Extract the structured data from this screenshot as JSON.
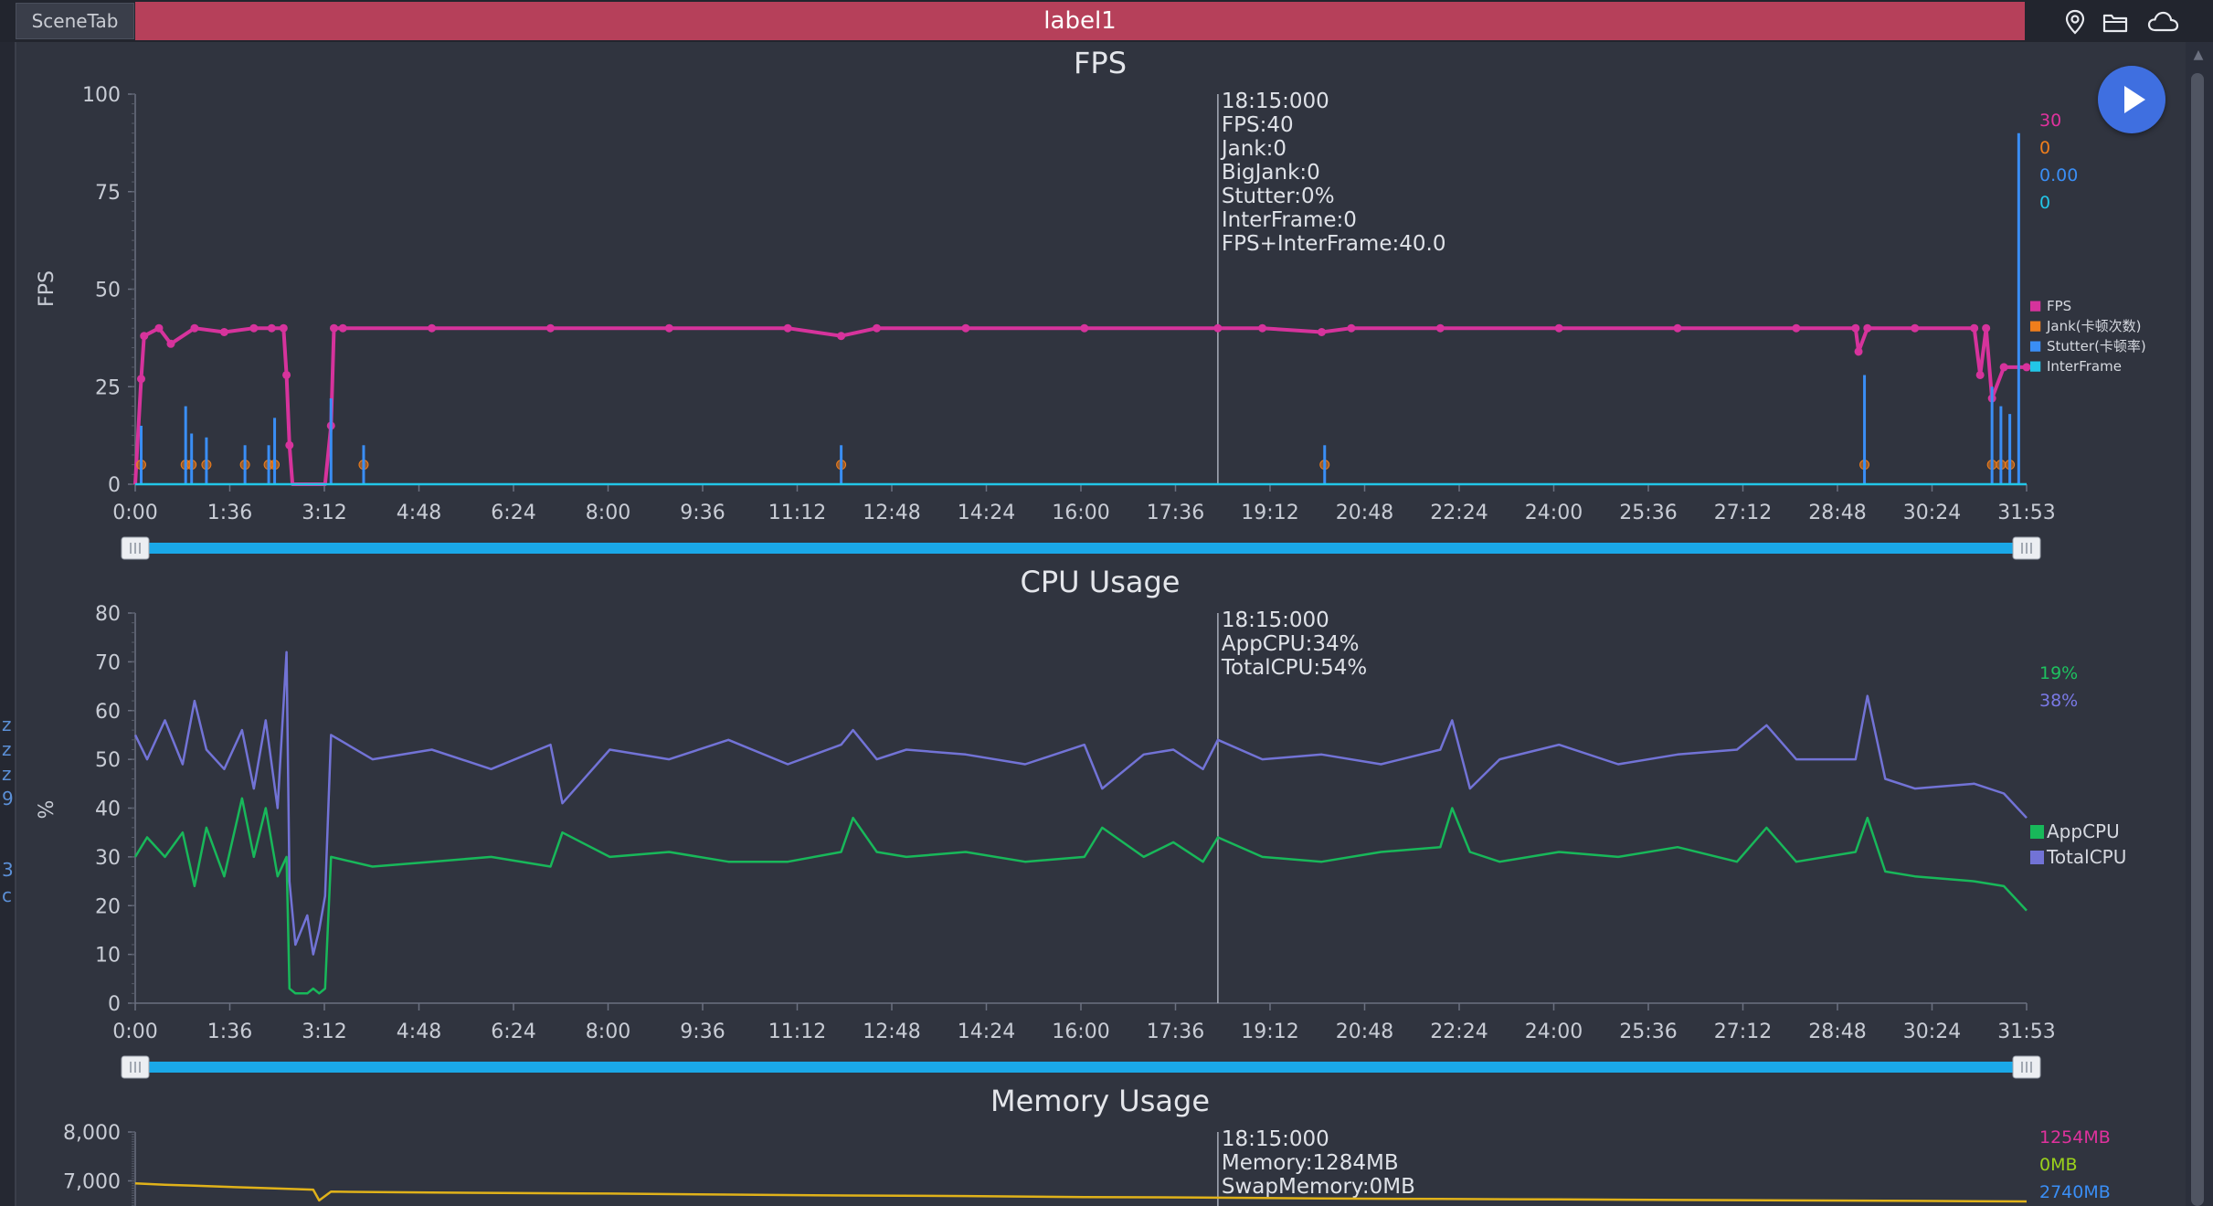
{
  "header": {
    "scene_tab": "SceneTab",
    "label": "label1",
    "icons": [
      "location-pin-icon",
      "folder-icon",
      "cloud-icon"
    ]
  },
  "sidebar_glyphs": [
    "z",
    "z",
    "z",
    "9",
    "3",
    "c"
  ],
  "play_button": {
    "icon": "play-icon",
    "color": "#3f6fe0"
  },
  "x_ticks": [
    "0:00",
    "1:36",
    "3:12",
    "4:48",
    "6:24",
    "8:00",
    "9:36",
    "11:12",
    "12:48",
    "14:24",
    "16:00",
    "17:36",
    "19:12",
    "20:48",
    "22:24",
    "24:00",
    "25:36",
    "27:12",
    "28:48",
    "30:24",
    "31:53"
  ],
  "cursor_time_minutes": 18.25,
  "chart_data": [
    {
      "type": "line",
      "title": "FPS",
      "ylabel": "FPS",
      "ylim": [
        0,
        100
      ],
      "y_ticks": [
        "100",
        "75",
        "50",
        "25",
        "0"
      ],
      "x_range_minutes": [
        0,
        31.883
      ],
      "legend_position": "right",
      "tooltip": [
        "18:15:000",
        "FPS:40",
        "Jank:0",
        "BigJank:0",
        "Stutter:0%",
        "InterFrame:0",
        "FPS+InterFrame:40.0"
      ],
      "current_values": [
        {
          "text": "30",
          "color": "#e0329e"
        },
        {
          "text": "0",
          "color": "#f07e1c"
        },
        {
          "text": "0.00",
          "color": "#3a8ef5"
        },
        {
          "text": "0",
          "color": "#22c6e8"
        }
      ],
      "series": [
        {
          "name": "FPS",
          "color": "#d6339c",
          "x": [
            0,
            0.1,
            0.15,
            0.4,
            0.6,
            1.0,
            1.5,
            2.0,
            2.3,
            2.5,
            2.55,
            2.6,
            2.65,
            3.2,
            3.3,
            3.35,
            3.5,
            5,
            7,
            9,
            11,
            11.9,
            12.5,
            14,
            16,
            18.25,
            19,
            20,
            20.5,
            22,
            24,
            26,
            28,
            29,
            29.05,
            29.2,
            30,
            31,
            31.1,
            31.2,
            31.3,
            31.5,
            31.883
          ],
          "values": [
            0,
            27,
            38,
            40,
            36,
            40,
            39,
            40,
            40,
            40,
            28,
            10,
            0,
            0,
            15,
            40,
            40,
            40,
            40,
            40,
            40,
            38,
            40,
            40,
            40,
            40,
            40,
            39,
            40,
            40,
            40,
            40,
            40,
            40,
            34,
            40,
            40,
            40,
            28,
            40,
            22,
            30,
            30
          ]
        },
        {
          "name": "Jank(卡顿次数)",
          "color": "#f07e1c",
          "x": [
            0.1,
            0.85,
            0.95,
            1.2,
            1.85,
            2.25,
            2.35,
            3.85,
            11.9,
            20.05,
            29.15,
            31.3,
            31.45,
            31.6
          ],
          "values": [
            5,
            5,
            5,
            5,
            5,
            5,
            5,
            5,
            5,
            5,
            5,
            5,
            5,
            5
          ]
        },
        {
          "name": "Stutter(卡顿率)",
          "color": "#3a8ef5",
          "x": [
            0.1,
            0.85,
            0.95,
            1.2,
            1.85,
            2.25,
            2.35,
            3.3,
            3.85,
            11.9,
            20.05,
            29.15,
            31.3,
            31.45,
            31.6,
            31.75
          ],
          "values": [
            15,
            20,
            13,
            12,
            10,
            10,
            17,
            22,
            10,
            10,
            10,
            28,
            25,
            20,
            18,
            90
          ]
        },
        {
          "name": "InterFrame",
          "color": "#22c6e8",
          "x": [
            0,
            31.883
          ],
          "values": [
            0,
            0
          ]
        }
      ]
    },
    {
      "type": "line",
      "title": "CPU Usage",
      "ylabel": "%",
      "ylim": [
        0,
        80
      ],
      "y_ticks": [
        "80",
        "70",
        "60",
        "50",
        "40",
        "30",
        "20",
        "10",
        "0"
      ],
      "x_range_minutes": [
        0,
        31.883
      ],
      "legend_position": "right",
      "tooltip": [
        "18:15:000",
        "AppCPU:34%",
        "TotalCPU:54%"
      ],
      "current_values": [
        {
          "text": "19%",
          "color": "#1ec15f"
        },
        {
          "text": "38%",
          "color": "#7a79e6"
        }
      ],
      "series": [
        {
          "name": "AppCPU",
          "color": "#18b85a",
          "x": [
            0,
            0.2,
            0.5,
            0.8,
            1.0,
            1.2,
            1.5,
            1.8,
            2.0,
            2.2,
            2.4,
            2.55,
            2.6,
            2.7,
            2.9,
            3.0,
            3.1,
            3.2,
            3.3,
            4,
            5,
            6,
            7,
            7.2,
            8,
            9,
            10,
            11,
            11.9,
            12.1,
            12.5,
            13,
            14,
            15,
            16,
            16.3,
            17,
            17.5,
            18,
            18.25,
            19,
            20,
            21,
            22,
            22.2,
            22.5,
            23,
            24,
            25,
            26,
            27,
            27.5,
            28,
            29,
            29.2,
            29.5,
            30,
            31,
            31.5,
            31.883
          ],
          "values": [
            30,
            34,
            30,
            35,
            24,
            36,
            26,
            42,
            30,
            40,
            26,
            30,
            3,
            2,
            2,
            3,
            2,
            3,
            30,
            28,
            29,
            30,
            28,
            35,
            30,
            31,
            29,
            29,
            31,
            38,
            31,
            30,
            31,
            29,
            30,
            36,
            30,
            33,
            29,
            34,
            30,
            29,
            31,
            32,
            40,
            31,
            29,
            31,
            30,
            32,
            29,
            36,
            29,
            31,
            38,
            27,
            26,
            25,
            24,
            19
          ]
        },
        {
          "name": "TotalCPU",
          "color": "#7273d6",
          "x": [
            0,
            0.2,
            0.5,
            0.8,
            1.0,
            1.2,
            1.5,
            1.8,
            2.0,
            2.2,
            2.4,
            2.55,
            2.6,
            2.7,
            2.9,
            3.0,
            3.1,
            3.2,
            3.3,
            4,
            5,
            6,
            7,
            7.2,
            8,
            9,
            10,
            11,
            11.9,
            12.1,
            12.5,
            13,
            14,
            15,
            16,
            16.3,
            17,
            17.5,
            18,
            18.25,
            19,
            20,
            21,
            22,
            22.2,
            22.5,
            23,
            24,
            25,
            26,
            27,
            27.5,
            28,
            29,
            29.2,
            29.5,
            30,
            31,
            31.5,
            31.883
          ],
          "values": [
            55,
            50,
            58,
            49,
            62,
            52,
            48,
            56,
            44,
            58,
            40,
            72,
            25,
            12,
            18,
            10,
            15,
            22,
            55,
            50,
            52,
            48,
            53,
            41,
            52,
            50,
            54,
            49,
            53,
            56,
            50,
            52,
            51,
            49,
            53,
            44,
            51,
            52,
            48,
            54,
            50,
            51,
            49,
            52,
            58,
            44,
            50,
            53,
            49,
            51,
            52,
            57,
            50,
            50,
            63,
            46,
            44,
            45,
            43,
            38
          ]
        }
      ]
    },
    {
      "type": "line",
      "title": "Memory Usage",
      "ylabel": "",
      "ylim": [
        6000,
        8000
      ],
      "y_ticks": [
        "8,000",
        "7,000"
      ],
      "x_range_minutes": [
        0,
        31.883
      ],
      "tooltip": [
        "18:15:000",
        "Memory:1284MB",
        "SwapMemory:0MB"
      ],
      "current_values": [
        {
          "text": "1254MB",
          "color": "#e0329e"
        },
        {
          "text": "0MB",
          "color": "#9bd21c"
        },
        {
          "text": "2740MB",
          "color": "#3a8ef5"
        }
      ],
      "series": [
        {
          "name": "",
          "color": "#e0b21a",
          "x": [
            0,
            0.5,
            1.0,
            2.0,
            3.0,
            3.1,
            3.3,
            5,
            8,
            10,
            12,
            14,
            16,
            18,
            20,
            22,
            24,
            26,
            28,
            30,
            31.883
          ],
          "values": [
            6950,
            6920,
            6900,
            6860,
            6820,
            6600,
            6780,
            6760,
            6740,
            6720,
            6700,
            6690,
            6670,
            6660,
            6640,
            6630,
            6620,
            6610,
            6600,
            6590,
            6580
          ]
        }
      ]
    }
  ]
}
